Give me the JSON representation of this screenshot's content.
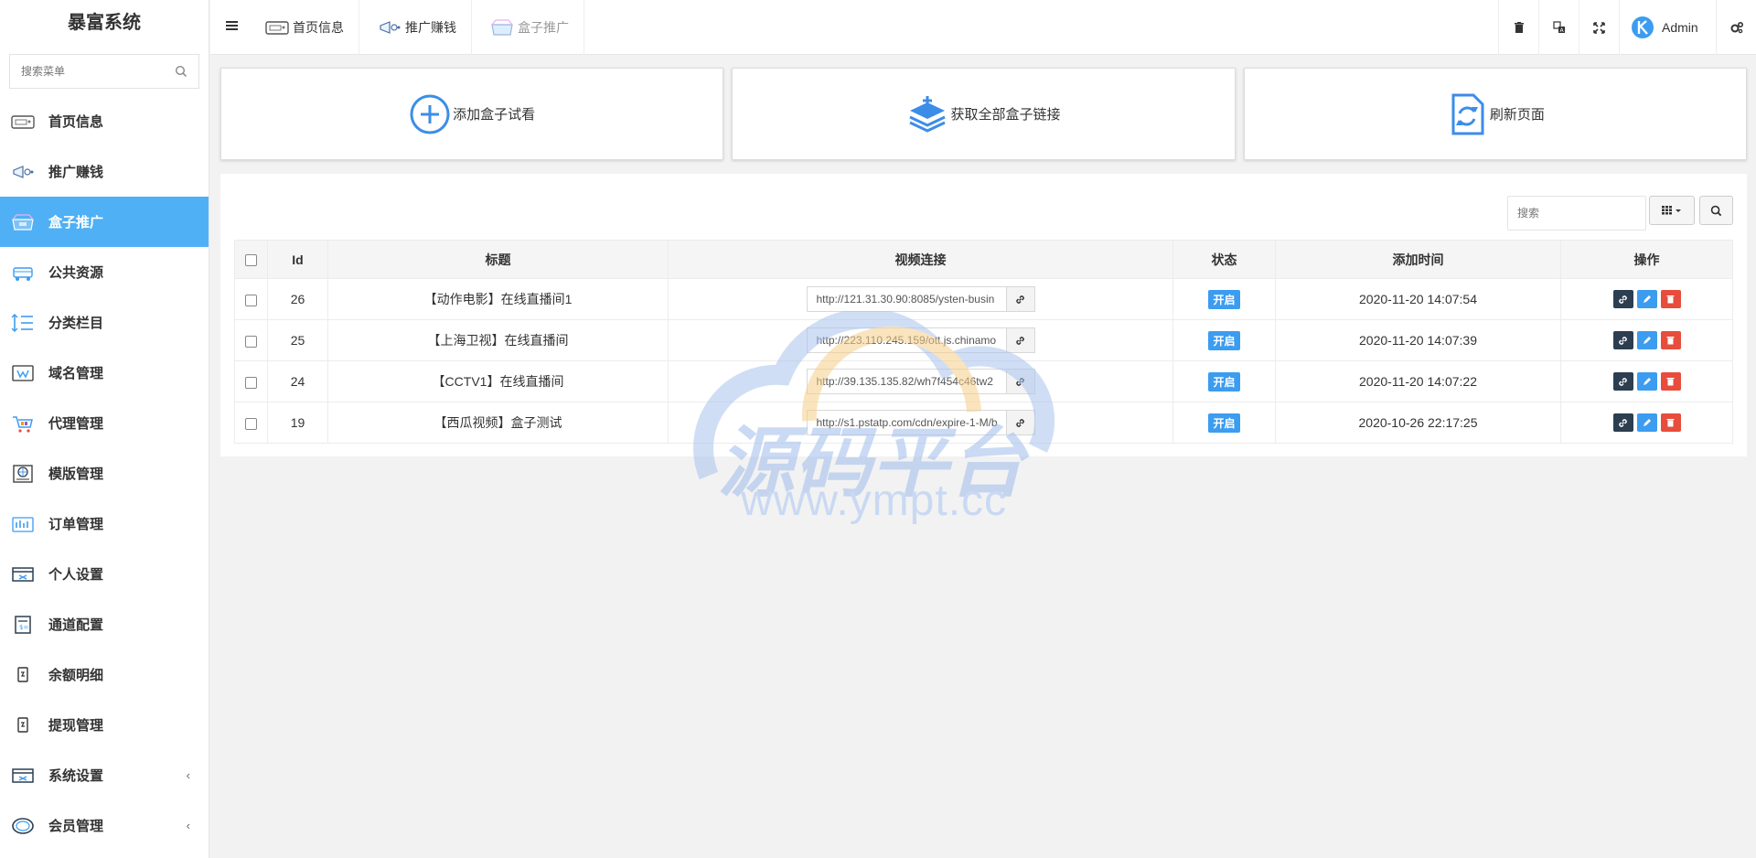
{
  "app": {
    "title": "暴富系统"
  },
  "sidebar": {
    "search_placeholder": "搜索菜单",
    "items": [
      {
        "label": "首页信息",
        "icon": "home-card-icon"
      },
      {
        "label": "推广赚钱",
        "icon": "megaphone-icon"
      },
      {
        "label": "盒子推广",
        "icon": "box-icon",
        "active": true
      },
      {
        "label": "公共资源",
        "icon": "resources-icon"
      },
      {
        "label": "分类栏目",
        "icon": "category-icon"
      },
      {
        "label": "域名管理",
        "icon": "domain-icon"
      },
      {
        "label": "代理管理",
        "icon": "agent-icon"
      },
      {
        "label": "模版管理",
        "icon": "template-icon"
      },
      {
        "label": "订单管理",
        "icon": "order-icon"
      },
      {
        "label": "个人设置",
        "icon": "personal-settings-icon"
      },
      {
        "label": "通道配置",
        "icon": "channel-icon"
      },
      {
        "label": "余额明细",
        "icon": "balance-icon"
      },
      {
        "label": "提现管理",
        "icon": "withdraw-icon"
      },
      {
        "label": "系统设置",
        "icon": "system-settings-icon",
        "has_arrow": true
      },
      {
        "label": "会员管理",
        "icon": "member-icon",
        "has_arrow": true
      }
    ]
  },
  "topnav": {
    "tabs": [
      {
        "label": "首页信息"
      },
      {
        "label": "推广赚钱"
      },
      {
        "label": "盒子推广"
      }
    ],
    "user": "Admin"
  },
  "actions": [
    {
      "label": "添加盒子试看",
      "icon": "plus-circle-icon"
    },
    {
      "label": "获取全部盒子链接",
      "icon": "layers-icon"
    },
    {
      "label": "刷新页面",
      "icon": "refresh-file-icon"
    }
  ],
  "table": {
    "search_placeholder": "搜索",
    "headers": [
      "Id",
      "标题",
      "视频连接",
      "状态",
      "添加时间",
      "操作"
    ],
    "rows": [
      {
        "id": "26",
        "title": "【动作电影】在线直播间1",
        "url": "http://121.31.30.90:8085/ysten-busin",
        "status": "开启",
        "time": "2020-11-20 14:07:54"
      },
      {
        "id": "25",
        "title": "【上海卫视】在线直播间",
        "url": "http://223.110.245.159/ott.js.chinamo",
        "status": "开启",
        "time": "2020-11-20 14:07:39"
      },
      {
        "id": "24",
        "title": "【CCTV1】在线直播间",
        "url": "http://39.135.135.82/wh7f454c46tw2",
        "status": "开启",
        "time": "2020-11-20 14:07:22"
      },
      {
        "id": "19",
        "title": "【西瓜视频】盒子测试",
        "url": "http://s1.pstatp.com/cdn/expire-1-M/b",
        "status": "开启",
        "time": "2020-10-26 22:17:25"
      }
    ]
  },
  "watermark": {
    "title": "源码平台",
    "url": "www.ympt.cc"
  },
  "colors": {
    "accent": "#4fb0f5",
    "badge": "#3c9cf0",
    "danger": "#e74c3c",
    "dark": "#2c3e50"
  }
}
